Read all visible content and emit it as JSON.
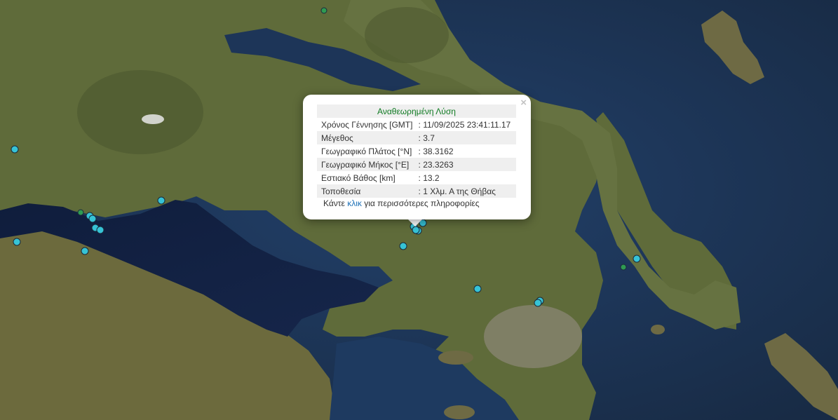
{
  "popup": {
    "title": "Αναθεωρημένη Λύση",
    "close_symbol": "×",
    "rows": [
      {
        "label": "Χρόνος Γέννησης [GMT]",
        "value": ": 11/09/2025 23:41:11.17"
      },
      {
        "label": "Μέγεθος",
        "value": ": 3.7"
      },
      {
        "label": "Γεωγραφικό Πλάτος [°N]",
        "value": ": 38.3162"
      },
      {
        "label": "Γεωγραφικό Μήκος [°E]",
        "value": ": 23.3263"
      },
      {
        "label": "Εστιακό Βάθος [km]",
        "value": ": 13.2"
      },
      {
        "label": "Τοποθεσία",
        "value": ": 1 Χλμ. Α της Θήβας"
      }
    ],
    "more_prefix": "Κάντε ",
    "more_link": "κλικ",
    "more_suffix": " για περισσότερες πληροφορίες"
  },
  "colors": {
    "marker_cyan": "#36c3d6",
    "marker_green": "#2f9b52",
    "sea": "#1d3550",
    "land": "#5f6b3a",
    "title_green": "#0f7a22",
    "link_blue": "#1f72b8"
  }
}
